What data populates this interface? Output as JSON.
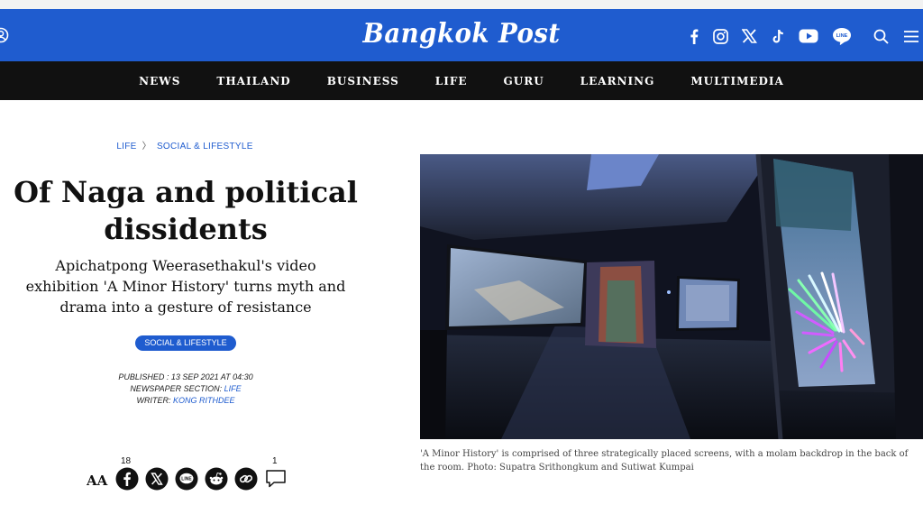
{
  "header": {
    "logo": "Bangkok Post",
    "icons": [
      "account-icon",
      "facebook-icon",
      "instagram-icon",
      "x-icon",
      "tiktok-icon",
      "youtube-icon",
      "line-icon",
      "search-icon",
      "menu-icon"
    ],
    "line_label": "LINE"
  },
  "nav": {
    "items": [
      {
        "label": "NEWS"
      },
      {
        "label": "THAILAND"
      },
      {
        "label": "BUSINESS"
      },
      {
        "label": "LIFE"
      },
      {
        "label": "GURU"
      },
      {
        "label": "LEARNING"
      },
      {
        "label": "MULTIMEDIA"
      }
    ]
  },
  "article": {
    "breadcrumb": {
      "section": "LIFE",
      "separator": "〉",
      "subsection": "SOCIAL & LIFESTYLE"
    },
    "title": "Of Naga and political dissidents",
    "subtitle": "Apichatpong Weerasethakul's video exhibition 'A Minor History' turns myth and drama into a gesture of resistance",
    "tag": "SOCIAL & LIFESTYLE",
    "meta": {
      "published_label": "PUBLISHED : ",
      "published_value": "13 SEP 2021 AT 04:30",
      "section_label": "NEWSPAPER SECTION: ",
      "section_value": "LIFE",
      "writer_label": "WRITER: ",
      "writer_value": "KONG RITHDEE"
    },
    "share": {
      "font_size_label": "AA",
      "facebook_count": "18",
      "comment_count": "1"
    },
    "photo_caption": "'A Minor History' is comprised of three strategically placed screens, with a molam backdrop in the back of the room. Photo: Supatra Srithongkum and Sutiwat Kumpai"
  },
  "colors": {
    "brand_blue": "#1f5ccf",
    "nav_black": "#111111"
  }
}
